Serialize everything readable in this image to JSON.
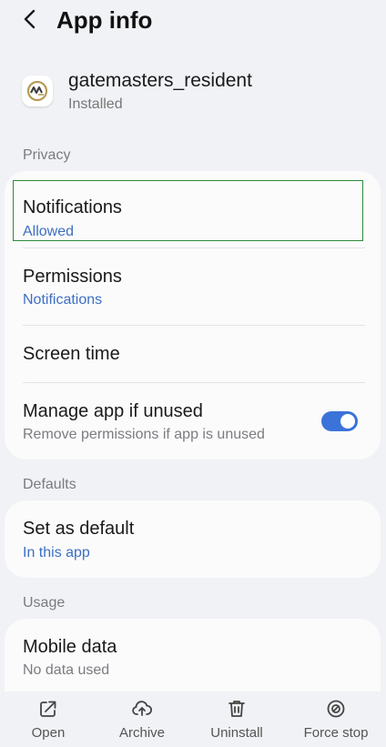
{
  "header": {
    "title": "App info"
  },
  "app": {
    "name": "gatemasters_resident",
    "status": "Installed"
  },
  "sections": {
    "privacy": "Privacy",
    "defaults": "Defaults",
    "usage": "Usage"
  },
  "privacy_rows": {
    "notifications": {
      "title": "Notifications",
      "value": "Allowed"
    },
    "permissions": {
      "title": "Permissions",
      "value": "Notifications"
    },
    "screen_time": {
      "title": "Screen time"
    },
    "manage_unused": {
      "title": "Manage app if unused",
      "description": "Remove permissions if app is unused",
      "enabled": true
    }
  },
  "defaults_rows": {
    "set_default": {
      "title": "Set as default",
      "value": "In this app"
    }
  },
  "usage_rows": {
    "mobile_data": {
      "title": "Mobile data",
      "value": "No data used"
    }
  },
  "bottom_actions": {
    "open": "Open",
    "archive": "Archive",
    "uninstall": "Uninstall",
    "force_stop": "Force stop"
  },
  "colors": {
    "background": "#f1f2f6",
    "card": "#fbfbfc",
    "accent_blue": "#3e6fc0",
    "toggle_on": "#3b73d9",
    "focus_outline": "#2e8b3e"
  }
}
